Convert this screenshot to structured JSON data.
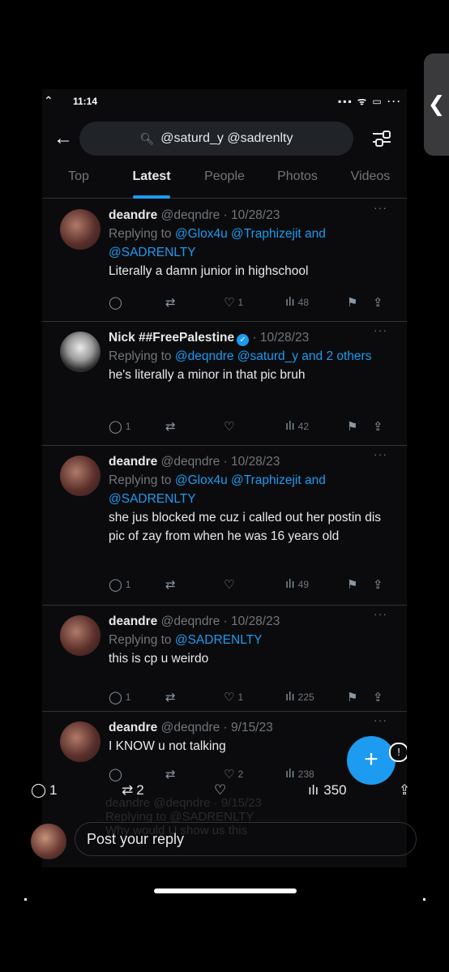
{
  "status": {
    "time": "11:14",
    "icons": "▪▪▪ ᯤ ▭ ···"
  },
  "search": {
    "query": "@saturd_y @sadrenlty"
  },
  "tabs": [
    "Top",
    "Latest",
    "People",
    "Photos",
    "Videos"
  ],
  "tweets": [
    {
      "name": "deandre",
      "handle": "@deqndre · 10/28/23",
      "replying_prefix": "Replying to ",
      "replying_to": "@Glox4u @Traphizejit and @SADRENLTY",
      "text": "Literally a damn junior in highschool",
      "replies": "",
      "retweets": "",
      "likes": "1",
      "views": "48"
    },
    {
      "name": "Nick ##FreePalestine",
      "verified": true,
      "handle": "· 10/28/23",
      "replying_prefix": "Replying to ",
      "replying_to": "@deqndre @saturd_y and 2 others",
      "text": "he's literally a minor in that pic bruh",
      "replies": "1",
      "retweets": "",
      "likes": "",
      "views": "42"
    },
    {
      "name": "deandre",
      "handle": "@deqndre · 10/28/23",
      "replying_prefix": "Replying to ",
      "replying_to": "@Glox4u @Traphizejit and @SADRENLTY",
      "text": "she jus blocked me cuz i called out her postin dis pic of zay from when he was 16 years old",
      "replies": "1",
      "retweets": "",
      "likes": "",
      "views": "49"
    },
    {
      "name": "deandre",
      "handle": "@deqndre · 10/28/23",
      "replying_prefix": "Replying to ",
      "replying_to": "@SADRENLTY",
      "text": "this is cp u weirdo",
      "replies": "1",
      "retweets": "",
      "likes": "1",
      "views": "225"
    },
    {
      "name": "deandre",
      "handle": "@deqndre · 9/15/23",
      "replying_prefix": "",
      "replying_to": "",
      "text": "I KNOW u not talking",
      "replies": "",
      "retweets": "",
      "likes": "2",
      "views": "238"
    }
  ],
  "bottom_stats": {
    "replies": "1",
    "retweets": "2",
    "views": "350"
  },
  "ghost": {
    "line1": "deandre @deqndre · 9/15/23",
    "line2": "Replying to @SADRENLTY",
    "line3": "Why would U show us this"
  },
  "reply_box": {
    "placeholder": "Post your reply"
  },
  "fab": {
    "label": "+",
    "badge": "!"
  },
  "side_handle": {
    "label": "❮"
  },
  "colors": {
    "accent": "#1d9bf0",
    "background": "#000000",
    "muted": "#71767b"
  }
}
